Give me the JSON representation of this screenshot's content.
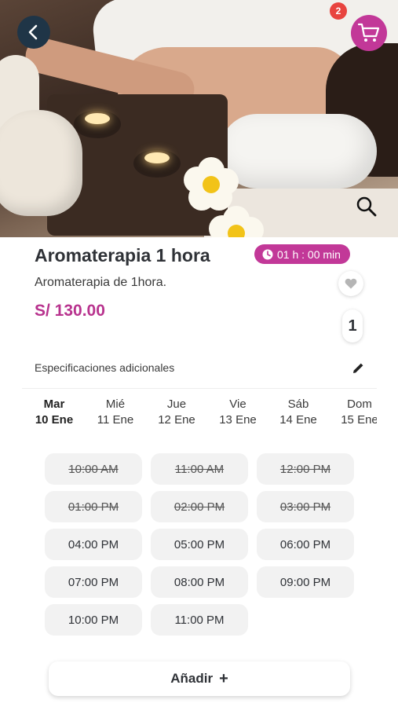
{
  "header": {
    "cart_count": "2"
  },
  "product": {
    "title": "Aromaterapia 1 hora",
    "duration": "01 h : 00 min",
    "description": "Aromaterapia de 1hora.",
    "price": "S/ 130.00",
    "quantity": "1"
  },
  "specs": {
    "label": "Especificaciones adicionales"
  },
  "dates": [
    {
      "day": "Mar",
      "date": "10 Ene",
      "selected": true
    },
    {
      "day": "Mié",
      "date": "11 Ene",
      "selected": false
    },
    {
      "day": "Jue",
      "date": "12 Ene",
      "selected": false
    },
    {
      "day": "Vie",
      "date": "13 Ene",
      "selected": false
    },
    {
      "day": "Sáb",
      "date": "14 Ene",
      "selected": false
    },
    {
      "day": "Dom",
      "date": "15 Ene",
      "selected": false
    }
  ],
  "slots": [
    {
      "time": "10:00 AM",
      "available": false
    },
    {
      "time": "11:00 AM",
      "available": false
    },
    {
      "time": "12:00 PM",
      "available": false
    },
    {
      "time": "01:00 PM",
      "available": false
    },
    {
      "time": "02:00 PM",
      "available": false
    },
    {
      "time": "03:00 PM",
      "available": false
    },
    {
      "time": "04:00 PM",
      "available": true
    },
    {
      "time": "05:00 PM",
      "available": true
    },
    {
      "time": "06:00 PM",
      "available": true
    },
    {
      "time": "07:00 PM",
      "available": true
    },
    {
      "time": "08:00 PM",
      "available": true
    },
    {
      "time": "09:00 PM",
      "available": true
    },
    {
      "time": "10:00 PM",
      "available": true
    },
    {
      "time": "11:00 PM",
      "available": true
    }
  ],
  "add_button": {
    "label": "Añadir",
    "icon": "+"
  },
  "colors": {
    "accent": "#c23898",
    "price": "#b8338e",
    "back_button": "#1f3547",
    "badge": "#e8443f",
    "slot_bg": "#f2f2f2"
  },
  "icons": {
    "back": "chevron-left-icon",
    "cart": "cart-icon",
    "zoom": "search-icon",
    "duration": "clock-icon",
    "favorite": "heart-icon",
    "edit": "pencil-icon",
    "add": "plus-icon"
  }
}
